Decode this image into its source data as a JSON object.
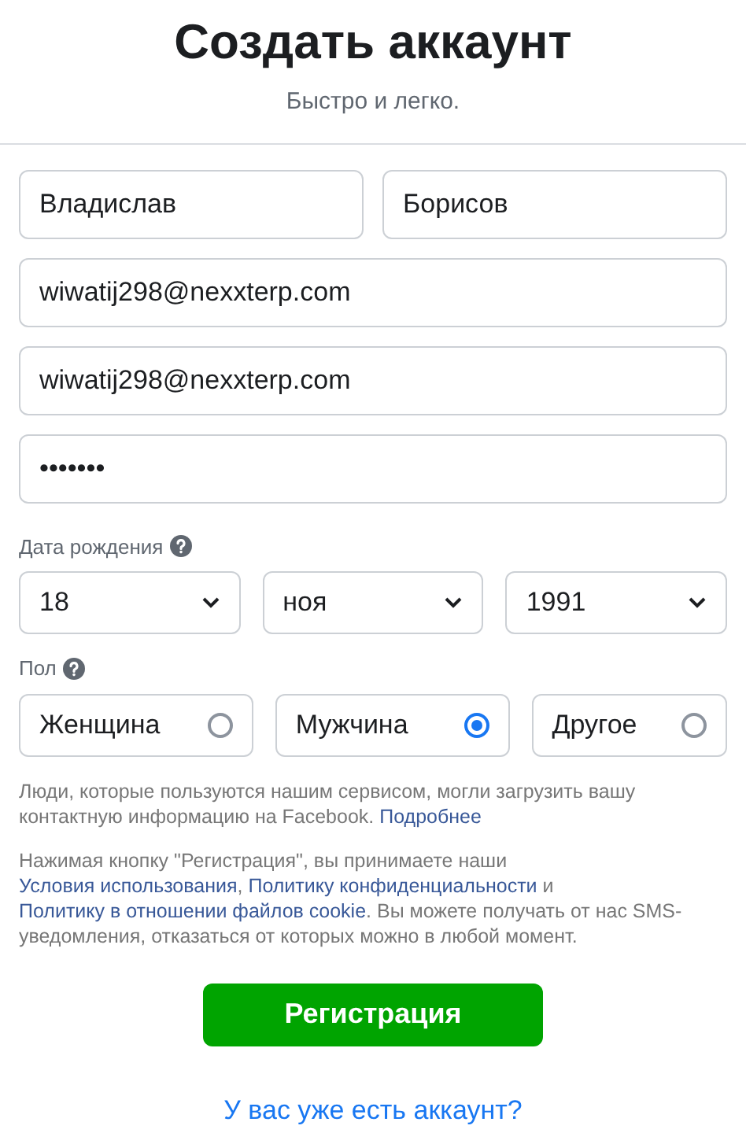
{
  "header": {
    "title": "Создать аккаунт",
    "subtitle": "Быстро и легко."
  },
  "name_fields": [
    {
      "value": "Владислав"
    },
    {
      "value": "Борисов"
    }
  ],
  "fields": [
    {
      "value": "wiwatij298@nexxterp.com"
    },
    {
      "value": "wiwatij298@nexxterp.com"
    },
    {
      "value": "•••••••"
    }
  ],
  "birthday": {
    "label": "Дата рождения",
    "selects": [
      {
        "value": "18"
      },
      {
        "value": "ноя"
      },
      {
        "value": "1991"
      }
    ]
  },
  "gender": {
    "label": "Пол",
    "options": [
      {
        "label": "Женщина",
        "selected": false
      },
      {
        "label": "Мужчина",
        "selected": true
      },
      {
        "label": "Другое",
        "selected": false
      }
    ]
  },
  "notices": [
    [
      {
        "kind": "text",
        "text": "Люди, которые пользуются нашим сервисом, могли загрузить вашу контактную информацию на Facebook. "
      },
      {
        "kind": "link",
        "text": "Подробнее"
      }
    ],
    [
      {
        "kind": "text",
        "text": "Нажимая кнопку \"Регистрация\", вы принимаете наши "
      },
      {
        "kind": "link",
        "text": "Условия использования"
      },
      {
        "kind": "text",
        "text": ", "
      },
      {
        "kind": "link",
        "text": "Политику конфиденциальности"
      },
      {
        "kind": "text",
        "text": " и "
      },
      {
        "kind": "link",
        "text": "Политику в отношении файлов cookie"
      },
      {
        "kind": "text",
        "text": ". Вы можете получать от нас SMS-уведомления, отказаться от которых можно в любой момент."
      }
    ]
  ],
  "submit_button": "Регистрация",
  "login_link": "У вас уже есть аккаунт?"
}
